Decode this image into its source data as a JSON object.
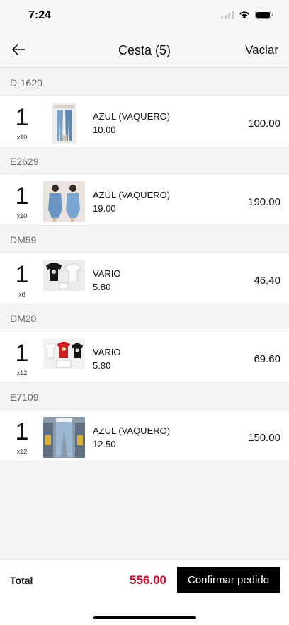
{
  "status_bar": {
    "time": "7:24",
    "icons": [
      "signal-icon",
      "wifi-icon",
      "battery-icon"
    ]
  },
  "nav": {
    "back_icon": "arrow-left-icon",
    "title": "Cesta (5)",
    "action_label": "Vaciar"
  },
  "groups": [
    {
      "code": "D-1620",
      "quantity": "1",
      "multiplier": "x10",
      "description": "AZUL (VAQUERO)",
      "unit_price": "10.00",
      "line_total": "100.00",
      "thumbnail": "jeans-product-photo"
    },
    {
      "code": "E2629",
      "quantity": "1",
      "multiplier": "x10",
      "description": "AZUL (VAQUERO)",
      "unit_price": "19.00",
      "line_total": "190.00",
      "thumbnail": "denim-dress-product-photo"
    },
    {
      "code": "DM59",
      "quantity": "1",
      "multiplier": "x8",
      "description": "VARIO",
      "unit_price": "5.80",
      "line_total": "46.40",
      "thumbnail": "tshirts-product-photo"
    },
    {
      "code": "DM20",
      "quantity": "1",
      "multiplier": "x12",
      "description": "VARIO",
      "unit_price": "5.80",
      "line_total": "69.60",
      "thumbnail": "printed-tshirts-product-photo"
    },
    {
      "code": "E7109",
      "quantity": "1",
      "multiplier": "x12",
      "description": "AZUL (VAQUERO)",
      "unit_price": "12.50",
      "line_total": "150.00",
      "thumbnail": "jeans-display-product-photo"
    }
  ],
  "footer": {
    "total_label": "Total",
    "total_value": "556.00",
    "confirm_label": "Confirmar pedido"
  },
  "colors": {
    "accent_total": "#c8102e",
    "button_bg": "#000000"
  }
}
